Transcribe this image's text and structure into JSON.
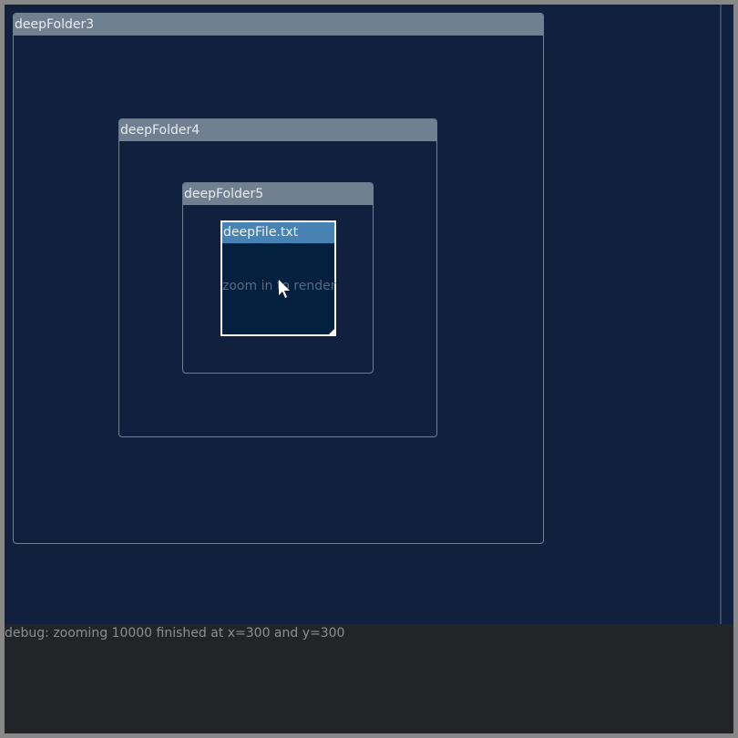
{
  "folders": [
    {
      "title": "deepFolder3"
    },
    {
      "title": "deepFolder4"
    },
    {
      "title": "deepFolder5"
    }
  ],
  "file": {
    "title": "deepFile.txt",
    "placeholder": "zoom in to render"
  },
  "debug": {
    "text": "debug: zooming 10000 finished at x=300 and y=300"
  }
}
